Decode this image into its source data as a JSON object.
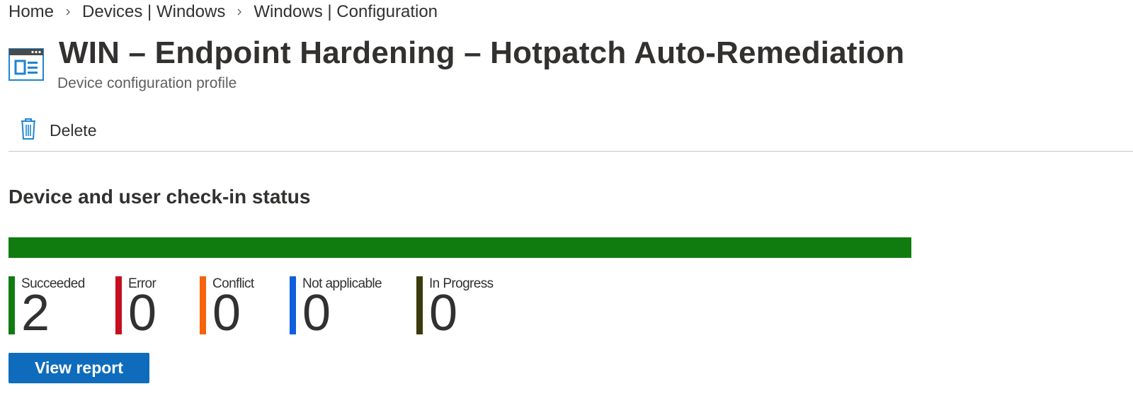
{
  "breadcrumb": [
    {
      "label": "Home"
    },
    {
      "label": "Devices | Windows"
    },
    {
      "label": "Windows | Configuration"
    }
  ],
  "header": {
    "title": "WIN – Endpoint Hardening – Hotpatch Auto-Remediation",
    "subtitle": "Device configuration profile",
    "icon": "configuration-profile-icon"
  },
  "toolbar": {
    "delete_label": "Delete",
    "delete_icon": "trash-icon"
  },
  "status_section": {
    "title": "Device and user check-in status",
    "stats": [
      {
        "key": "succeeded",
        "label": "Succeeded",
        "value": "2",
        "color": "#107c10"
      },
      {
        "key": "error",
        "label": "Error",
        "value": "0",
        "color": "#c50f1f"
      },
      {
        "key": "conflict",
        "label": "Conflict",
        "value": "0",
        "color": "#f7630c"
      },
      {
        "key": "not-applicable",
        "label": "Not applicable",
        "value": "0",
        "color": "#0f5fdc"
      },
      {
        "key": "in-progress",
        "label": "In Progress",
        "value": "0",
        "color": "#3b3a0c"
      }
    ],
    "view_report_label": "View report"
  },
  "colors": {
    "primary_button": "#0f6cbd",
    "icon_blue": "#1f85d0"
  }
}
